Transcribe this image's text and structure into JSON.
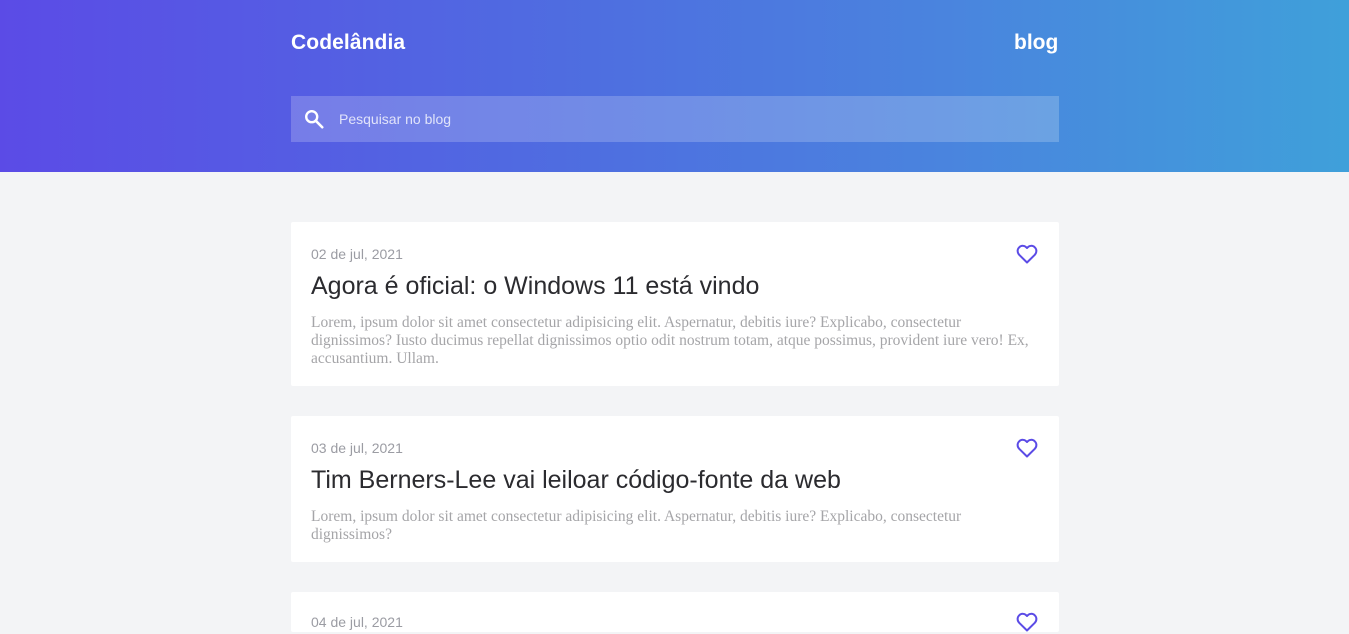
{
  "header": {
    "brand": "Codelândia",
    "nav_link": "blog"
  },
  "search": {
    "placeholder": "Pesquisar no blog",
    "icon": "search-icon"
  },
  "posts": [
    {
      "date": "02 de jul, 2021",
      "title": "Agora é oficial: o Windows 11 está vindo",
      "excerpt": "Lorem, ipsum dolor sit amet consectetur adipisicing elit. Aspernatur, debitis iure? Explicabo, consectetur dignissimos? Iusto ducimus repellat dignissimos optio odit nostrum totam, atque possimus, provident iure vero! Ex, accusantium. Ullam."
    },
    {
      "date": "03 de jul, 2021",
      "title": "Tim Berners-Lee vai leiloar código-fonte da web",
      "excerpt": "Lorem, ipsum dolor sit amet consectetur adipisicing elit. Aspernatur, debitis iure? Explicabo, consectetur dignissimos?"
    },
    {
      "date": "04 de jul, 2021",
      "title": "",
      "excerpt": ""
    }
  ],
  "colors": {
    "accent": "#5b4be6",
    "heart": "#5b4be6"
  }
}
